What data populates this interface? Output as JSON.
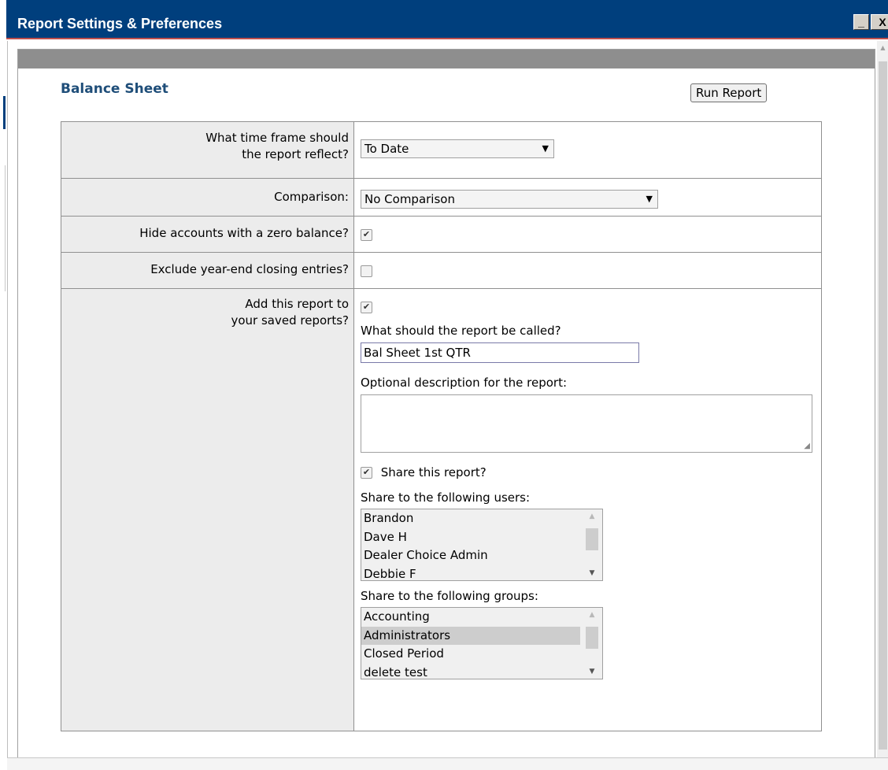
{
  "window": {
    "title": "Report Settings & Preferences",
    "minimize_glyph": "_",
    "close_glyph": "X"
  },
  "report": {
    "title": "Balance Sheet",
    "run_label": "Run Report"
  },
  "form": {
    "time_frame": {
      "label_line1": "What time frame should",
      "label_line2": "the report reflect?",
      "value": "To Date"
    },
    "comparison": {
      "label": "Comparison:",
      "value": "No Comparison"
    },
    "hide_zero": {
      "label": "Hide accounts with a zero balance?",
      "checked": true
    },
    "exclude_closing": {
      "label": "Exclude year-end closing entries?",
      "checked": false
    },
    "save_report": {
      "label_line1": "Add this report to",
      "label_line2": "your saved reports?",
      "checked": true,
      "name_label": "What should the report be called?",
      "name_value": "Bal Sheet 1st QTR",
      "description_label": "Optional description for the report:",
      "description_value": "",
      "share_label": "Share this report?",
      "share_checked": true,
      "users_label": "Share to the following users:",
      "users": [
        "Brandon",
        "Dave H",
        "Dealer Choice Admin",
        "Debbie F"
      ],
      "groups_label": "Share to the following groups:",
      "groups": [
        "Accounting",
        "Administrators",
        "Closed Period",
        "delete test"
      ],
      "selected_group": "Administrators"
    }
  },
  "icons": {
    "check": "✔",
    "dropdown": "▼",
    "scroll_up": "▲",
    "scroll_down": "▼",
    "resize_grip": "◢"
  },
  "colors": {
    "titlebar": "#003f7d",
    "titlebar_accent": "#c0504d",
    "report_title": "#1f4e79",
    "label_cell_bg": "#ececec",
    "header_bar": "#8e8e8e"
  }
}
